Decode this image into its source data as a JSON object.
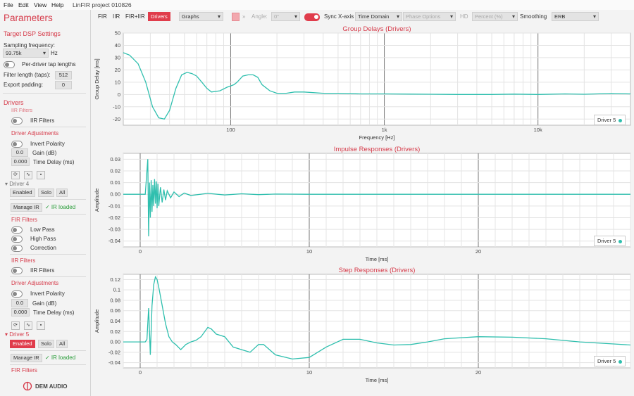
{
  "menu": {
    "items": [
      "File",
      "Edit",
      "View",
      "Help"
    ],
    "title": "LinFIR project 010826"
  },
  "sidebar": {
    "heading": "Parameters",
    "target_dsp": "Target DSP Settings",
    "sampling_label": "Sampling frequency:",
    "sampling_value": "93.75k",
    "sampling_unit": "Hz",
    "per_driver": "Per-driver tap lengths",
    "filter_length_label": "Filter length (taps):",
    "filter_length_value": "512",
    "export_padding_label": "Export padding:",
    "export_padding_value": "0",
    "drivers_heading": "Drivers",
    "iir_filters_partial": "IIR Filters",
    "iir_filters": "IIR Filters",
    "driver_adjustments": "Driver Adjustments",
    "invert_polarity": "Invert Polarity",
    "gain_value": "0.0",
    "gain_label": "Gain (dB)",
    "time_delay_value": "0.000",
    "time_delay_label": "Time Delay (ms)",
    "driver4": "Driver 4",
    "enabled": "Enabled",
    "solo": "Solo",
    "all": "All",
    "manage_ir": "Manage IR",
    "ir_loaded": "✓ IR loaded",
    "fir_filters": "FIR Filters",
    "low_pass": "Low Pass",
    "high_pass": "High Pass",
    "correction": "Correction",
    "driver5": "Driver 5",
    "logo": "DEM AUDIO"
  },
  "toolbar": {
    "fir": "FIR",
    "iir": "IIR",
    "firiir": "FIR+IIR",
    "drivers": "Drivers",
    "graphs": "Graphs",
    "angle_label": "Angle:",
    "angle_value": "0°",
    "sync_label": "Sync X-axis",
    "domain": "Time Domain",
    "phase": "Phase Options",
    "hd": "HD",
    "percent": "Percent (%)",
    "smoothing_label": "Smoothing",
    "smoothing_value": "ERB"
  },
  "colors": {
    "accent": "#e03c4b",
    "trace": "#2fbfae",
    "title": "#d63b4a"
  },
  "chart_data": [
    {
      "type": "line",
      "title": "Group Delays (Drivers)",
      "xlabel": "Frequency [Hz]",
      "ylabel": "Group Delay [ms]",
      "xscale": "log",
      "xlim": [
        20,
        40000
      ],
      "ylim": [
        -25,
        50
      ],
      "xticks": [
        {
          "v": 100,
          "label": "100"
        },
        {
          "v": 1000,
          "label": "1k"
        },
        {
          "v": 10000,
          "label": "10k"
        }
      ],
      "yticks": [
        -20,
        -10,
        0,
        10,
        20,
        30,
        40,
        50
      ],
      "legend": "Driver 5",
      "series": [
        {
          "name": "Driver 5",
          "x": [
            20,
            22,
            25,
            28,
            31,
            34,
            37,
            40,
            44,
            48,
            52,
            56,
            60,
            65,
            70,
            75,
            85,
            95,
            100,
            105,
            110,
            120,
            130,
            140,
            150,
            160,
            180,
            200,
            230,
            260,
            300,
            400,
            500,
            700,
            1000,
            1500,
            2000,
            3000,
            5000,
            7000,
            10000,
            15000,
            20000,
            30000,
            40000
          ],
          "y": [
            34,
            32,
            25,
            10,
            -10,
            -19,
            -20,
            -13,
            5,
            16,
            18,
            17,
            15,
            10,
            5,
            2,
            3,
            6,
            7,
            8,
            10,
            15,
            16,
            16,
            14,
            8,
            3,
            1,
            1,
            2,
            2,
            1,
            1,
            0.5,
            0.5,
            0.3,
            0.2,
            0,
            0,
            0.3,
            0,
            0.5,
            0.2,
            0.8,
            0.5
          ]
        }
      ]
    },
    {
      "type": "line",
      "title": "Impulse Responses (Drivers)",
      "xlabel": "Time [ms]",
      "ylabel": "Amplitude",
      "xlim": [
        -1,
        29
      ],
      "ylim": [
        -0.045,
        0.035
      ],
      "xticks": [
        {
          "v": 0,
          "label": "0"
        },
        {
          "v": 10,
          "label": "10"
        },
        {
          "v": 20,
          "label": "20"
        }
      ],
      "yticks": [
        {
          "v": 0.03,
          "label": "0.03"
        },
        {
          "v": 0.02,
          "label": "0.02"
        },
        {
          "v": 0.01,
          "label": "0.01"
        },
        {
          "v": 0,
          "label": "0.00"
        },
        {
          "v": -0.01,
          "label": "-0.01"
        },
        {
          "v": -0.02,
          "label": "-0.02"
        },
        {
          "v": -0.03,
          "label": "-0.03"
        },
        {
          "v": -0.04,
          "label": "-0.04"
        }
      ],
      "legend": "Driver 5",
      "series": [
        {
          "name": "Driver 5",
          "x": [
            -1,
            0.3,
            0.45,
            0.5,
            0.55,
            0.6,
            0.65,
            0.7,
            0.75,
            0.8,
            0.85,
            0.9,
            0.95,
            1.0,
            1.05,
            1.1,
            1.2,
            1.3,
            1.4,
            1.5,
            1.6,
            1.8,
            2.0,
            2.3,
            2.6,
            3,
            4,
            5,
            6,
            7,
            8,
            10,
            15,
            20,
            25,
            29
          ],
          "y": [
            0,
            0,
            0.03,
            -0.036,
            0.01,
            -0.02,
            0.012,
            -0.015,
            0.008,
            -0.01,
            0.013,
            -0.008,
            0.011,
            -0.012,
            0.009,
            -0.01,
            0.006,
            -0.007,
            0.004,
            -0.005,
            0.003,
            -0.003,
            0.002,
            -0.002,
            0.001,
            -0.001,
            0.0008,
            -0.0006,
            0.0004,
            -0.0003,
            0.0002,
            0,
            0,
            0,
            0,
            0
          ]
        }
      ]
    },
    {
      "type": "line",
      "title": "Step Responses (Drivers)",
      "xlabel": "Time [ms]",
      "ylabel": "Amplitude",
      "xlim": [
        -1,
        29
      ],
      "ylim": [
        -0.05,
        0.13
      ],
      "xticks": [
        {
          "v": 0,
          "label": "0"
        },
        {
          "v": 10,
          "label": "10"
        },
        {
          "v": 20,
          "label": "20"
        }
      ],
      "yticks": [
        {
          "v": 0.12,
          "label": "0.12"
        },
        {
          "v": 0.1,
          "label": "0.1"
        },
        {
          "v": 0.08,
          "label": "0.08"
        },
        {
          "v": 0.06,
          "label": "0.06"
        },
        {
          "v": 0.04,
          "label": "0.04"
        },
        {
          "v": 0.02,
          "label": "0.02"
        },
        {
          "v": 0,
          "label": "0.00"
        },
        {
          "v": -0.02,
          "label": "-0.02"
        },
        {
          "v": -0.04,
          "label": "-0.04"
        }
      ],
      "legend": "Driver 5",
      "series": [
        {
          "name": "Driver 5",
          "x": [
            -1,
            0.3,
            0.4,
            0.5,
            0.55,
            0.6,
            0.7,
            0.8,
            0.9,
            1.0,
            1.1,
            1.3,
            1.5,
            1.7,
            1.9,
            2.1,
            2.4,
            2.7,
            3.0,
            3.3,
            3.6,
            4.0,
            4.2,
            4.5,
            5.0,
            5.5,
            6.0,
            6.5,
            7.0,
            7.3,
            8,
            9,
            10,
            11,
            12,
            13,
            14,
            15,
            16,
            17,
            18,
            20,
            22,
            24,
            26,
            28,
            29
          ],
          "y": [
            0,
            0,
            0.005,
            0.065,
            0.02,
            -0.025,
            0.07,
            0.11,
            0.125,
            0.12,
            0.105,
            0.07,
            0.035,
            0.01,
            0.0,
            -0.005,
            -0.015,
            -0.005,
            0.0,
            0.003,
            0.01,
            0.028,
            0.025,
            0.015,
            0.01,
            -0.01,
            -0.015,
            -0.02,
            -0.005,
            -0.005,
            -0.025,
            -0.033,
            -0.03,
            -0.01,
            0.005,
            0.005,
            -0.002,
            -0.006,
            -0.005,
            0.0,
            0.006,
            0.01,
            0.009,
            0.006,
            0.0,
            -0.004,
            -0.006
          ]
        }
      ]
    }
  ]
}
